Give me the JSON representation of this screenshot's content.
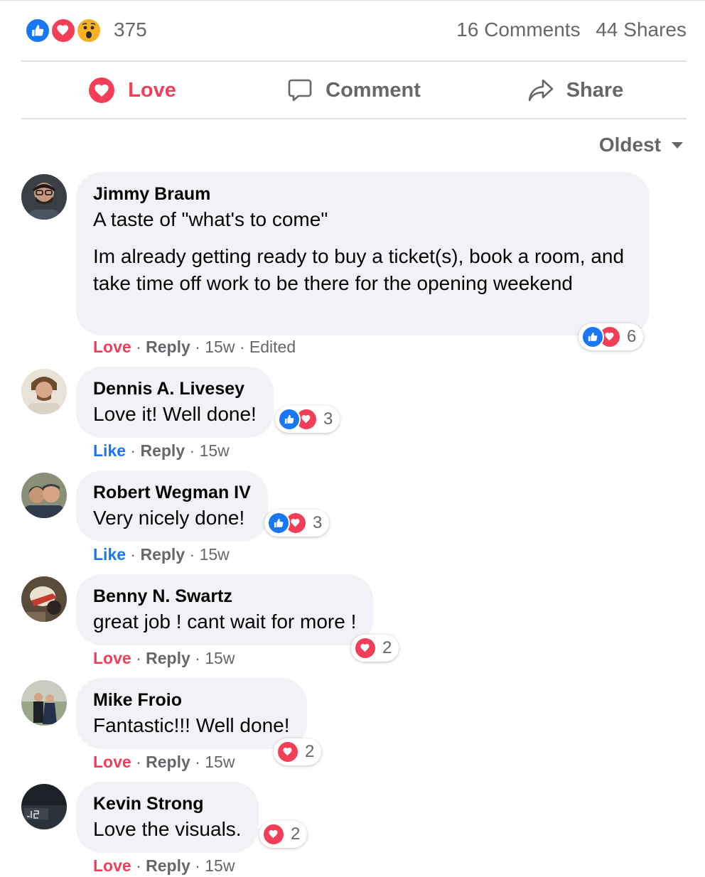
{
  "summary": {
    "reaction_icons": [
      "like-icon",
      "love-icon",
      "wow-icon"
    ],
    "reaction_count": "375",
    "comments": "16 Comments",
    "shares": "44 Shares"
  },
  "actions": {
    "love": "Love",
    "comment": "Comment",
    "share": "Share"
  },
  "sort": {
    "label": "Oldest"
  },
  "colors": {
    "like_blue": "#1877f2",
    "love_red": "#f33e58",
    "wow_yellow": "#f7b125",
    "bubble": "#f0f2f5",
    "muted": "#65676b"
  },
  "comments": [
    {
      "author": "Jimmy Braum",
      "paragraphs": [
        "A taste of \"what's to come\"",
        "Im already getting ready to buy a ticket(s), book a room, and take time off work to be there for the opening weekend"
      ],
      "reaction_label": "Love",
      "reply": "Reply",
      "time": "15w",
      "edited": "Edited",
      "reactions": [
        "like-icon",
        "love-icon"
      ],
      "reaction_count": "6"
    },
    {
      "author": "Dennis A. Livesey",
      "paragraphs": [
        "Love it! Well done!"
      ],
      "reaction_label": "Like",
      "reply": "Reply",
      "time": "15w",
      "reactions": [
        "like-icon",
        "love-icon"
      ],
      "reaction_count": "3"
    },
    {
      "author": "Robert Wegman IV",
      "paragraphs": [
        "Very nicely done!"
      ],
      "reaction_label": "Like",
      "reply": "Reply",
      "time": "15w",
      "reactions": [
        "like-icon",
        "love-icon"
      ],
      "reaction_count": "3"
    },
    {
      "author": "Benny N. Swartz",
      "paragraphs": [
        "great job ! cant wait for more !"
      ],
      "reaction_label": "Love",
      "reply": "Reply",
      "time": "15w",
      "reactions": [
        "love-icon"
      ],
      "reaction_count": "2"
    },
    {
      "author": "Mike Froio",
      "paragraphs": [
        "Fantastic!!! Well done!"
      ],
      "reaction_label": "Love",
      "reply": "Reply",
      "time": "15w",
      "reactions": [
        "love-icon"
      ],
      "reaction_count": "2"
    },
    {
      "author": "Kevin Strong",
      "paragraphs": [
        "Love the visuals."
      ],
      "reaction_label": "Love",
      "reply": "Reply",
      "time": "15w",
      "reactions": [
        "love-icon"
      ],
      "reaction_count": "2"
    }
  ]
}
